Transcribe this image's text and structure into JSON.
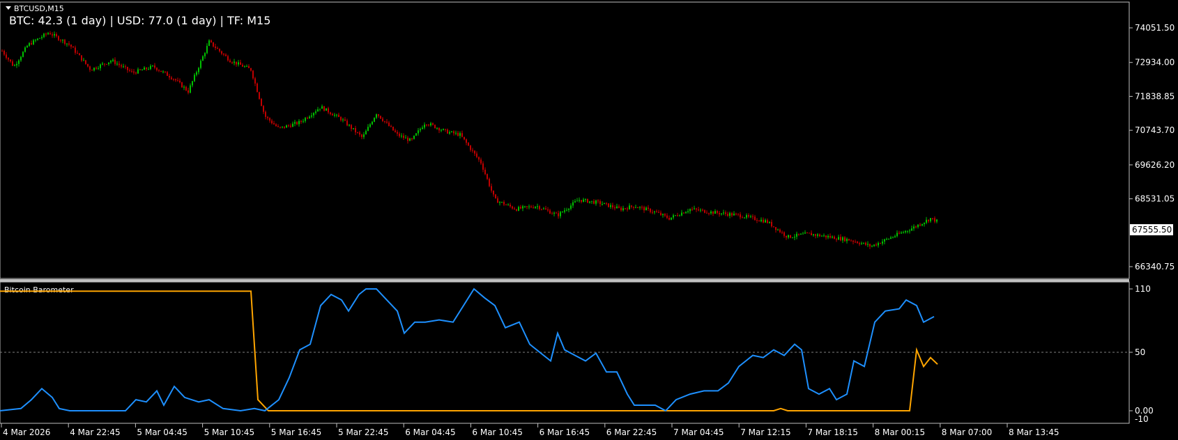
{
  "main_panel": {
    "symbol_label": "BTCUSD,M15",
    "info_text": "BTC: 42.3 (1 day) | USD: 77.0 (1 day) | TF: M15",
    "price_ticks": [
      "74051.50",
      "72934.00",
      "71838.85",
      "70743.70",
      "69626.20",
      "68531.05",
      "67555.50",
      "66340.75"
    ],
    "current_price": "67555.50"
  },
  "indicator_panel": {
    "title": "Bitcoin Barometer",
    "ticks": [
      "110",
      "50",
      "0.00",
      "-10"
    ]
  },
  "time_axis": {
    "labels": [
      "4 Mar 2026",
      "4 Mar 22:45",
      "5 Mar 04:45",
      "5 Mar 10:45",
      "5 Mar 16:45",
      "5 Mar 22:45",
      "6 Mar 04:45",
      "6 Mar 10:45",
      "6 Mar 16:45",
      "6 Mar 22:45",
      "7 Mar 04:45",
      "7 Mar 12:15",
      "7 Mar 18:15",
      "8 Mar 00:15",
      "8 Mar 07:00",
      "8 Mar 13:45"
    ]
  },
  "chart_data": {
    "type": "line",
    "price_path": [
      [
        0,
        73400
      ],
      [
        20,
        72800
      ],
      [
        40,
        73500
      ],
      [
        70,
        73900
      ],
      [
        100,
        73500
      ],
      [
        130,
        72700
      ],
      [
        160,
        73000
      ],
      [
        190,
        72600
      ],
      [
        220,
        72800
      ],
      [
        250,
        72400
      ],
      [
        270,
        72000
      ],
      [
        300,
        73600
      ],
      [
        330,
        73000
      ],
      [
        360,
        72700
      ],
      [
        380,
        71200
      ],
      [
        400,
        70800
      ],
      [
        430,
        71000
      ],
      [
        460,
        71500
      ],
      [
        490,
        71100
      ],
      [
        520,
        70500
      ],
      [
        540,
        71300
      ],
      [
        570,
        70600
      ],
      [
        590,
        70400
      ],
      [
        610,
        71000
      ],
      [
        640,
        70700
      ],
      [
        660,
        70600
      ],
      [
        690,
        69700
      ],
      [
        710,
        68500
      ],
      [
        740,
        68200
      ],
      [
        770,
        68300
      ],
      [
        800,
        68000
      ],
      [
        830,
        68500
      ],
      [
        860,
        68400
      ],
      [
        890,
        68200
      ],
      [
        910,
        68300
      ],
      [
        940,
        68100
      ],
      [
        960,
        67900
      ],
      [
        990,
        68200
      ],
      [
        1020,
        68100
      ],
      [
        1060,
        68000
      ],
      [
        1100,
        67800
      ],
      [
        1130,
        67300
      ],
      [
        1160,
        67400
      ],
      [
        1190,
        67300
      ],
      [
        1220,
        67200
      ],
      [
        1250,
        67000
      ],
      [
        1280,
        67300
      ],
      [
        1310,
        67600
      ],
      [
        1335,
        67900
      ],
      [
        1345,
        67800
      ]
    ],
    "blue_series": [
      [
        0,
        0
      ],
      [
        30,
        2
      ],
      [
        45,
        10
      ],
      [
        60,
        20
      ],
      [
        75,
        12
      ],
      [
        85,
        2
      ],
      [
        100,
        0
      ],
      [
        140,
        0
      ],
      [
        180,
        0
      ],
      [
        195,
        10
      ],
      [
        210,
        8
      ],
      [
        225,
        18
      ],
      [
        235,
        5
      ],
      [
        250,
        22
      ],
      [
        265,
        12
      ],
      [
        285,
        8
      ],
      [
        300,
        10
      ],
      [
        320,
        2
      ],
      [
        345,
        0
      ],
      [
        365,
        2
      ],
      [
        380,
        0
      ],
      [
        400,
        10
      ],
      [
        415,
        30
      ],
      [
        430,
        55
      ],
      [
        445,
        60
      ],
      [
        460,
        95
      ],
      [
        475,
        105
      ],
      [
        490,
        100
      ],
      [
        500,
        90
      ],
      [
        515,
        105
      ],
      [
        525,
        110
      ],
      [
        540,
        110
      ],
      [
        555,
        100
      ],
      [
        570,
        90
      ],
      [
        580,
        70
      ],
      [
        595,
        80
      ],
      [
        610,
        80
      ],
      [
        630,
        82
      ],
      [
        650,
        80
      ],
      [
        665,
        95
      ],
      [
        680,
        110
      ],
      [
        695,
        102
      ],
      [
        710,
        95
      ],
      [
        725,
        75
      ],
      [
        745,
        80
      ],
      [
        760,
        60
      ],
      [
        780,
        50
      ],
      [
        790,
        45
      ],
      [
        800,
        70
      ],
      [
        810,
        55
      ],
      [
        825,
        50
      ],
      [
        840,
        45
      ],
      [
        855,
        52
      ],
      [
        870,
        35
      ],
      [
        885,
        35
      ],
      [
        900,
        15
      ],
      [
        910,
        5
      ],
      [
        925,
        5
      ],
      [
        940,
        5
      ],
      [
        955,
        0
      ],
      [
        970,
        10
      ],
      [
        990,
        15
      ],
      [
        1010,
        18
      ],
      [
        1030,
        18
      ],
      [
        1045,
        25
      ],
      [
        1060,
        40
      ],
      [
        1080,
        50
      ],
      [
        1095,
        48
      ],
      [
        1110,
        55
      ],
      [
        1125,
        50
      ],
      [
        1140,
        60
      ],
      [
        1150,
        55
      ],
      [
        1160,
        20
      ],
      [
        1175,
        15
      ],
      [
        1190,
        20
      ],
      [
        1200,
        10
      ],
      [
        1215,
        15
      ],
      [
        1225,
        45
      ],
      [
        1240,
        40
      ],
      [
        1255,
        80
      ],
      [
        1270,
        90
      ],
      [
        1290,
        92
      ],
      [
        1300,
        100
      ],
      [
        1315,
        95
      ],
      [
        1325,
        80
      ],
      [
        1340,
        85
      ]
    ],
    "orange_series": [
      [
        0,
        108
      ],
      [
        360,
        108
      ],
      [
        370,
        10
      ],
      [
        385,
        0
      ],
      [
        1000,
        0
      ],
      [
        1110,
        0
      ],
      [
        1120,
        2
      ],
      [
        1130,
        0
      ],
      [
        1305,
        0
      ],
      [
        1315,
        55
      ],
      [
        1325,
        40
      ],
      [
        1335,
        48
      ],
      [
        1345,
        42
      ]
    ]
  },
  "colors": {
    "bull": "#00c000",
    "bear": "#c00000",
    "blue_line": "#1e90ff",
    "orange_line": "#ffa500",
    "separator": "#c0c0c0",
    "axis": "#c0c0c0"
  }
}
